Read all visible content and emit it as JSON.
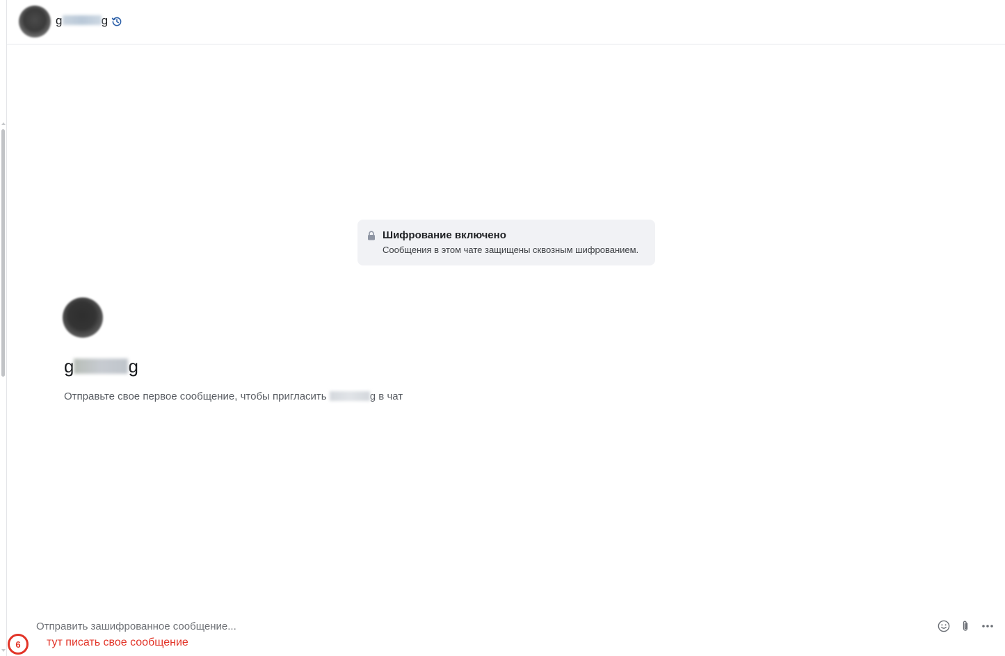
{
  "header": {
    "contact_name_start": "g",
    "contact_name_end": "g"
  },
  "encryption_notice": {
    "title": "Шифрование включено",
    "subtitle": "Сообщения в этом чате защищены сквозным шифрованием."
  },
  "intro": {
    "name_start": "g",
    "name_end": "g",
    "text_before": "Отправьте свое первое сообщение, чтобы пригласить ",
    "text_after": "g в чат"
  },
  "composer": {
    "placeholder": "Отправить зашифрованное сообщение..."
  },
  "annotation": {
    "number": "6",
    "text": "тут писать свое сообщение"
  },
  "icons": {
    "history": "history-icon",
    "lock": "lock-icon",
    "emoji": "smiley-icon",
    "attach": "paperclip-icon",
    "more": "more-dots-icon"
  },
  "colors": {
    "annotation": "#e23327",
    "history_icon": "#2b5fa8",
    "notice_bg": "#f1f2f5"
  }
}
